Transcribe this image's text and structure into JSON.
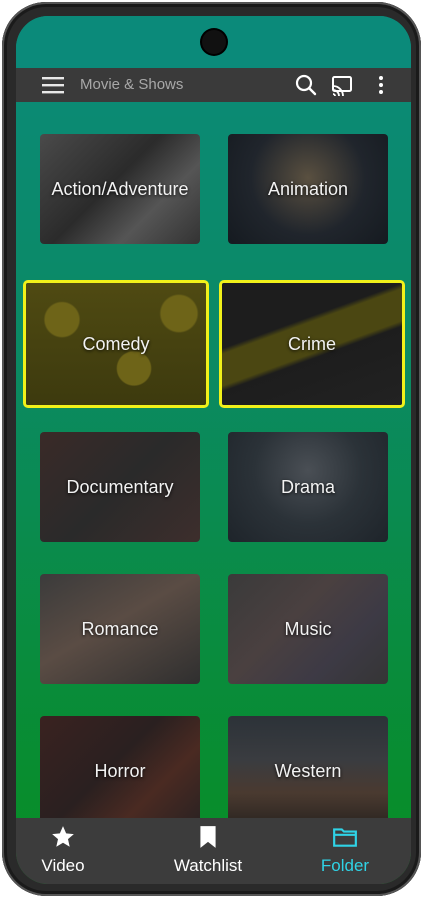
{
  "app": {
    "title": "Movie & Shows"
  },
  "toolbar": {
    "menu_icon": "hamburger-menu-icon",
    "search_icon": "search-icon",
    "cast_icon": "cast-icon",
    "more_icon": "more-vert-icon"
  },
  "categories": [
    {
      "label": "Action/Adventure",
      "selected": false
    },
    {
      "label": "Animation",
      "selected": false
    },
    {
      "label": "Comedy",
      "selected": true
    },
    {
      "label": "Crime",
      "selected": true
    },
    {
      "label": "Documentary",
      "selected": false
    },
    {
      "label": "Drama",
      "selected": false
    },
    {
      "label": "Romance",
      "selected": false
    },
    {
      "label": "Music",
      "selected": false
    },
    {
      "label": "Horror",
      "selected": false
    },
    {
      "label": "Western",
      "selected": false
    }
  ],
  "bottom_nav": [
    {
      "label": "Video",
      "icon": "star-icon",
      "active": false
    },
    {
      "label": "Watchlist",
      "icon": "bookmark-icon",
      "active": false
    },
    {
      "label": "Folder",
      "icon": "folder-icon",
      "active": true
    }
  ],
  "colors": {
    "selected_border": "#f1f11a",
    "active_nav": "#2fd3e6",
    "appbar": "#3a3a3a"
  }
}
